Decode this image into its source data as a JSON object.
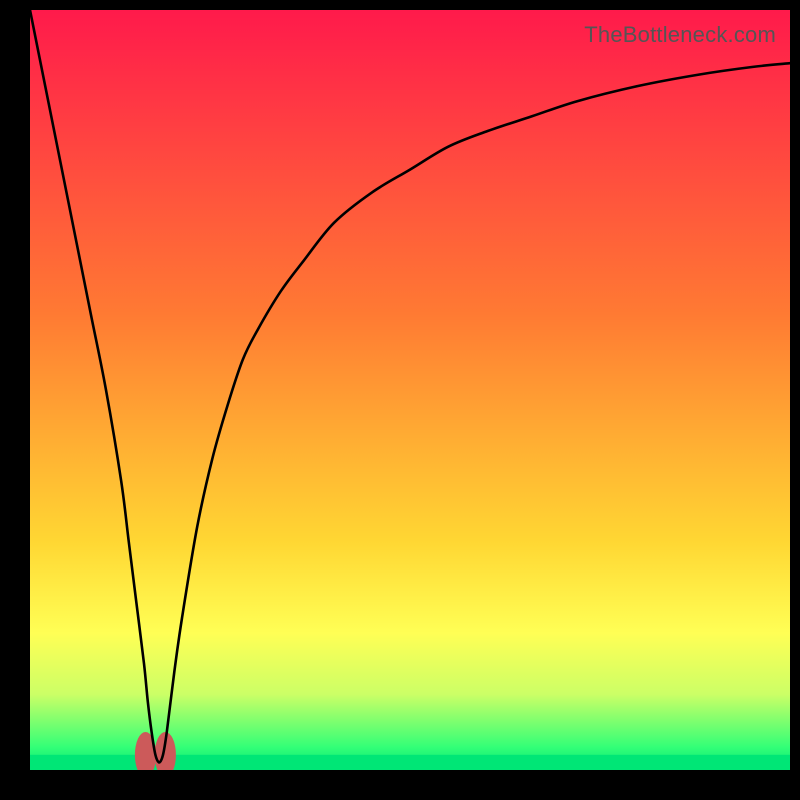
{
  "attribution": "TheBottleneck.com",
  "chart_data": {
    "type": "line",
    "title": "",
    "xlabel": "",
    "ylabel": "",
    "xlim": [
      0,
      100
    ],
    "ylim": [
      0,
      100
    ],
    "grid": false,
    "legend": false,
    "gradient_stops": [
      {
        "offset": 0,
        "color": "#ff1a4b"
      },
      {
        "offset": 0.4,
        "color": "#ff7a33"
      },
      {
        "offset": 0.7,
        "color": "#ffd733"
      },
      {
        "offset": 0.82,
        "color": "#ffff55"
      },
      {
        "offset": 0.9,
        "color": "#ccff66"
      },
      {
        "offset": 0.97,
        "color": "#33ff77"
      },
      {
        "offset": 1.0,
        "color": "#00e676"
      }
    ],
    "series": [
      {
        "name": "bottleneck-curve",
        "stroke": "#000000",
        "stroke_width": 2.6,
        "x": [
          0,
          2,
          4,
          6,
          8,
          10,
          12,
          13,
          14,
          15,
          15.5,
          16,
          16.5,
          17,
          17.5,
          18,
          19,
          20,
          22,
          24,
          26,
          28,
          30,
          33,
          36,
          40,
          45,
          50,
          55,
          60,
          66,
          72,
          80,
          88,
          95,
          100
        ],
        "y": [
          100,
          90,
          80,
          70,
          60,
          50,
          38,
          30,
          22,
          14,
          9,
          5,
          2,
          1,
          2,
          5,
          13,
          20,
          32,
          41,
          48,
          54,
          58,
          63,
          67,
          72,
          76,
          79,
          82,
          84,
          86,
          88,
          90,
          91.5,
          92.5,
          93
        ]
      }
    ],
    "markers": [
      {
        "name": "min-marker-left",
        "shape": "rounded-blob",
        "color": "#cc5a5a",
        "cx": 15.2,
        "cy": 2.0,
        "rx": 1.4,
        "ry": 3.0
      },
      {
        "name": "min-marker-right",
        "shape": "rounded-blob",
        "color": "#cc5a5a",
        "cx": 17.8,
        "cy": 2.0,
        "rx": 1.4,
        "ry": 3.0
      }
    ],
    "bottom_bar": {
      "color": "#00e676",
      "height_fraction": 0.02
    }
  }
}
